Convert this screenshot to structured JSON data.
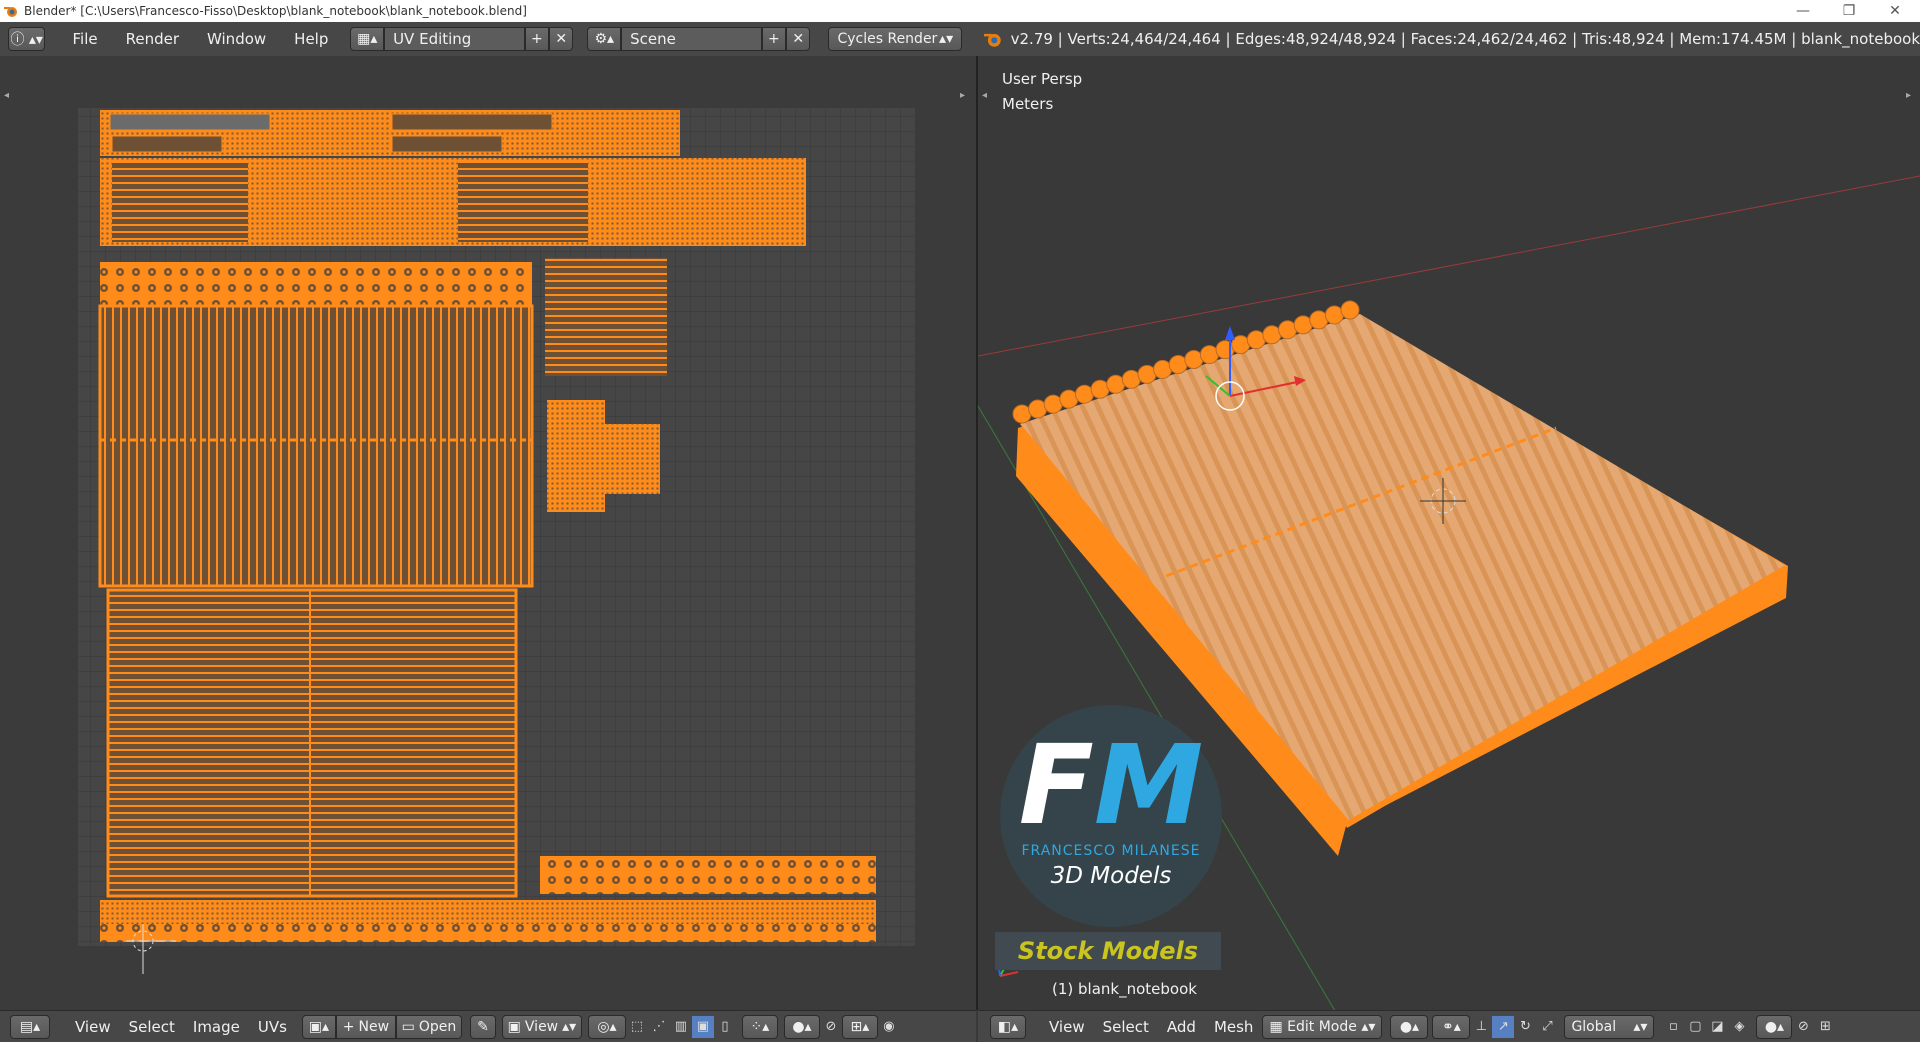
{
  "window": {
    "title": "Blender* [C:\\Users\\Francesco-Fisso\\Desktop\\blank_notebook\\blank_notebook.blend]"
  },
  "info_header": {
    "menus": [
      "File",
      "Render",
      "Window",
      "Help"
    ],
    "screen_layout": "UV Editing",
    "scene": "Scene",
    "render_engine": "Cycles Render",
    "stats": "v2.79 | Verts:24,464/24,464 | Edges:48,924/48,924 | Faces:24,462/24,462 | Tris:48,924 | Mem:174.45M | blank_notebook"
  },
  "viewport": {
    "view_name": "User Persp",
    "units": "Meters",
    "object_label": "(1) blank_notebook",
    "watermark": {
      "letters": "FM",
      "name": "FRANCESCO MILANESE",
      "subtitle": "3D Models",
      "banner": "Stock Models"
    }
  },
  "uv_footer": {
    "menus": [
      "View",
      "Select",
      "Image",
      "UVs"
    ],
    "new_label": "New",
    "open_label": "Open",
    "view_label": "View"
  },
  "viewport_footer": {
    "menus": [
      "View",
      "Select",
      "Add",
      "Mesh"
    ],
    "mode": "Edit Mode",
    "orientation": "Global"
  },
  "colors": {
    "accent_orange": "#ff8c1a",
    "panel_bg": "#474747",
    "editor_bg": "#393939"
  }
}
